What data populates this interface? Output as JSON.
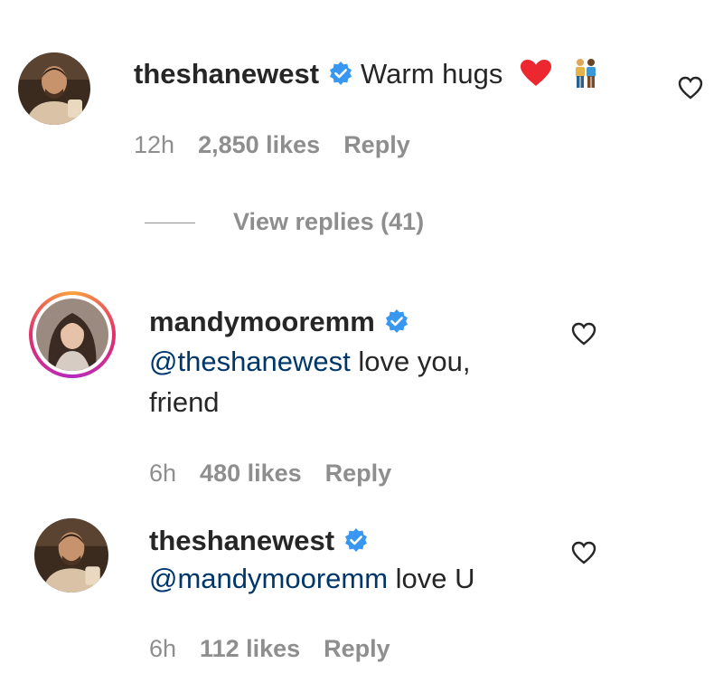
{
  "comments": [
    {
      "username": "theshanewest",
      "text": "Warm hugs",
      "emoji_heart": "❤",
      "emoji_people": "👫",
      "time": "12h",
      "likes": "2,850 likes",
      "reply": "Reply",
      "view_replies": "View replies (41)"
    },
    {
      "username": "mandymooremm",
      "mention": "@theshanewest",
      "text_line1": " love you,",
      "text_line2": "friend",
      "time": "6h",
      "likes": "480 likes",
      "reply": "Reply"
    },
    {
      "username": "theshanewest",
      "mention": "@mandymooremm",
      "text": " love U",
      "time": "6h",
      "likes": "112 likes",
      "reply": "Reply"
    }
  ],
  "colors": {
    "verified_blue": "#3897f0",
    "meta_gray": "#8e8e8e",
    "mention_blue": "#00376b",
    "heart_red": "#ed4956"
  }
}
